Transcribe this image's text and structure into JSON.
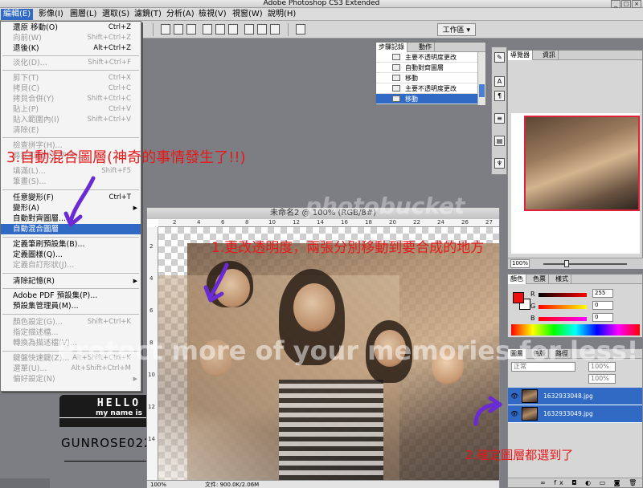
{
  "window": {
    "title": "Adobe Photoshop CS3 Extended",
    "controls": [
      "_",
      "□",
      "×"
    ]
  },
  "menubar": [
    {
      "label": "編輯(E)",
      "active": true
    },
    {
      "label": "影像(I)"
    },
    {
      "label": "圖層(L)"
    },
    {
      "label": "選取(S)"
    },
    {
      "label": "濾鏡(T)"
    },
    {
      "label": "分析(A)"
    },
    {
      "label": "檢視(V)"
    },
    {
      "label": "視窗(W)"
    },
    {
      "label": "說明(H)"
    }
  ],
  "optionsbar": {
    "workspace_label": "工作區 ▾"
  },
  "edit_menu": {
    "items": [
      {
        "label": "還原 移動(O)",
        "shortcut": "Ctrl+Z",
        "disabled": false
      },
      {
        "label": "向前(W)",
        "shortcut": "Shift+Ctrl+Z",
        "disabled": true
      },
      {
        "label": "退後(K)",
        "shortcut": "Alt+Ctrl+Z",
        "disabled": false
      },
      {
        "label": "淡化(D)...",
        "shortcut": "Shift+Ctrl+F",
        "disabled": true
      },
      {
        "label": "剪下(T)",
        "shortcut": "Ctrl+X",
        "disabled": true
      },
      {
        "label": "拷貝(C)",
        "shortcut": "Ctrl+C",
        "disabled": true
      },
      {
        "label": "拷貝合併(Y)",
        "shortcut": "Shift+Ctrl+C",
        "disabled": true
      },
      {
        "label": "貼上(P)",
        "shortcut": "Ctrl+V",
        "disabled": true
      },
      {
        "label": "貼入範圍內(I)",
        "shortcut": "Shift+Ctrl+V",
        "disabled": true
      },
      {
        "label": "清除(E)",
        "shortcut": "",
        "disabled": true
      },
      {
        "label": "檢查拼字(H)...",
        "shortcut": "",
        "disabled": true
      },
      {
        "label": "尋找和取代文字(X)...",
        "shortcut": "",
        "disabled": true
      },
      {
        "label": "填滿(L)...",
        "shortcut": "Shift+F5",
        "disabled": true
      },
      {
        "label": "筆畫(S)...",
        "shortcut": "",
        "disabled": true
      },
      {
        "label": "任意變形(F)",
        "shortcut": "Ctrl+T",
        "disabled": false
      },
      {
        "label": "變形(A)",
        "shortcut": "",
        "arrow": true,
        "disabled": false
      },
      {
        "label": "自動對齊圖層...",
        "shortcut": "",
        "disabled": false
      },
      {
        "label": "自動混合圖層",
        "shortcut": "",
        "disabled": false,
        "highlight": true
      },
      {
        "label": "定義筆刷預設集(B)...",
        "shortcut": "",
        "disabled": false
      },
      {
        "label": "定義圖樣(Q)...",
        "shortcut": "",
        "disabled": false
      },
      {
        "label": "定義自訂形狀(J)...",
        "shortcut": "",
        "disabled": true
      },
      {
        "label": "清除記憶(R)",
        "shortcut": "",
        "arrow": true,
        "disabled": false
      },
      {
        "label": "Adobe PDF 預設集(P)...",
        "shortcut": "",
        "disabled": false
      },
      {
        "label": "預設集管理員(M)...",
        "shortcut": "",
        "disabled": false
      },
      {
        "label": "顏色設定(G)...",
        "shortcut": "Shift+Ctrl+K",
        "disabled": true
      },
      {
        "label": "指定描述檔...",
        "shortcut": "",
        "disabled": true
      },
      {
        "label": "轉換為描述檔(V)...",
        "shortcut": "",
        "disabled": true
      },
      {
        "label": "鍵盤快速鍵(Z)...",
        "shortcut": "Alt+Shift+Ctrl+K",
        "disabled": true
      },
      {
        "label": "選單(U)...",
        "shortcut": "Alt+Shift+Ctrl+M",
        "disabled": true
      },
      {
        "label": "偏好設定(N)",
        "shortcut": "",
        "arrow": true,
        "disabled": true
      }
    ]
  },
  "document": {
    "title": "未命名2 @ 100% (RGB/8#)",
    "zoom": "100%",
    "file_info": "文件: 900.0K/2.06M",
    "ruler_top": [
      "2",
      "4",
      "6",
      "8",
      "10",
      "12",
      "14",
      "16",
      "18",
      "20",
      "22",
      "24",
      "26",
      "27"
    ],
    "ruler_left": [
      "2",
      "4",
      "6",
      "8",
      "10",
      "12",
      "14"
    ]
  },
  "history_panel": {
    "tabs": [
      "步驟記錄",
      "動作"
    ],
    "rows": [
      {
        "label": "主要不透明度更改",
        "selected": false
      },
      {
        "label": "自動對齊圖層",
        "selected": false
      },
      {
        "label": "移動",
        "selected": false
      },
      {
        "label": "主要不透明度更改",
        "selected": false
      },
      {
        "label": "移動",
        "selected": true
      }
    ]
  },
  "navigator_panel": {
    "tabs": [
      "導覽器",
      "資訊"
    ],
    "zoom": "100%"
  },
  "color_panel": {
    "tabs": [
      "顏色",
      "色票",
      "樣式"
    ],
    "channels": [
      {
        "label": "R",
        "value": "255"
      },
      {
        "label": "G",
        "value": "0"
      },
      {
        "label": "B",
        "value": "0"
      }
    ],
    "foreground": "#ee1010",
    "background": "#ffffff"
  },
  "layers_panel": {
    "tabs": [
      "圖層",
      "色版",
      "路徑"
    ],
    "mode": "正常",
    "opacity": "100%",
    "fill": "100%",
    "layers": [
      {
        "name": "1632933048.jpg",
        "selected": true
      },
      {
        "name": "1632933049.jpg",
        "selected": true
      }
    ],
    "footer": "∞ fx ◘ ◐ ▭ ◙ 🗑"
  },
  "annotations": {
    "step1": "1.更改透明度，兩張分別移動到要合成的地方",
    "step2": "2.確定圖層都選到了",
    "step3": "3.自動混合圖層(神奇的事情發生了!!)"
  },
  "badge": {
    "hello": "HELLO",
    "subtitle": "my name is",
    "name": "GUNROSE0220"
  },
  "watermark": {
    "main": "Protect more of your memories for less!",
    "brand": "photobucket"
  }
}
